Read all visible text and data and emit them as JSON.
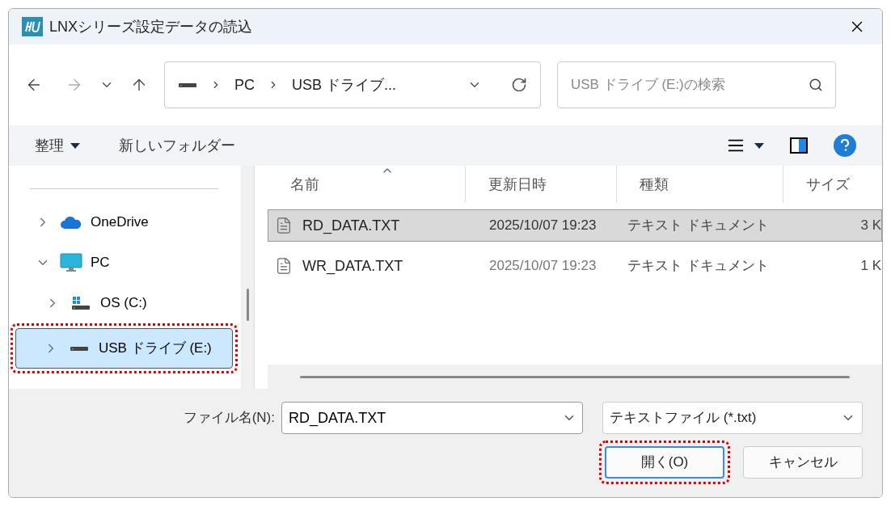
{
  "window": {
    "title": "LNXシリーズ設定データの読込"
  },
  "address": {
    "crumbs": [
      "PC",
      "USB ドライブ..."
    ]
  },
  "search": {
    "placeholder": "USB ドライブ (E:)の検索"
  },
  "commands": {
    "organize": "整理",
    "new_folder": "新しいフォルダー"
  },
  "sidebar": {
    "items": [
      {
        "label": "OneDrive",
        "kind": "cloud",
        "expanded": false,
        "selected": false,
        "annotated": false
      },
      {
        "label": "PC",
        "kind": "pc",
        "expanded": true,
        "selected": false,
        "annotated": false,
        "children": [
          {
            "label": "OS (C:)",
            "kind": "system-drive",
            "expanded": false,
            "selected": false,
            "annotated": false
          },
          {
            "label": "USB ドライブ (E:)",
            "kind": "drive",
            "expanded": false,
            "selected": true,
            "annotated": true
          }
        ]
      }
    ]
  },
  "table": {
    "columns": [
      "名前",
      "更新日時",
      "種類",
      "サイズ"
    ],
    "rows": [
      {
        "name": "RD_DATA.TXT",
        "modified": "2025/10/07 19:23",
        "type": "テキスト ドキュメント",
        "size": "3 K",
        "selected": true
      },
      {
        "name": "WR_DATA.TXT",
        "modified": "2025/10/07 19:23",
        "type": "テキスト ドキュメント",
        "size": "1 K",
        "selected": false
      }
    ]
  },
  "footer": {
    "filename_label": "ファイル名(N):",
    "filename": "RD_DATA.TXT",
    "filter": "テキストファイル (*.txt)",
    "buttons": [
      {
        "label": "開く(O)",
        "kind": "primary",
        "annotated": true
      },
      {
        "label": "キャンセル",
        "kind": "secondary",
        "annotated": false
      }
    ]
  }
}
